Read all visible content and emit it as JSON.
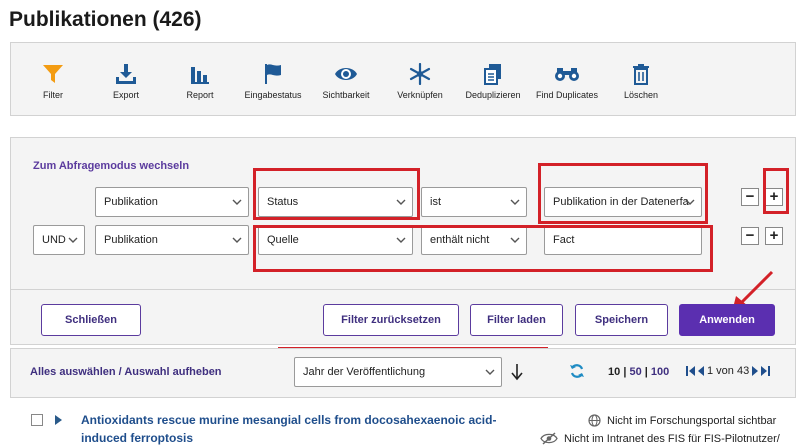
{
  "page": {
    "title": "Publikationen (426)"
  },
  "toolbar": {
    "items": [
      {
        "label": "Filter",
        "icon": "funnel-icon"
      },
      {
        "label": "Export",
        "icon": "download-icon"
      },
      {
        "label": "Report",
        "icon": "bar-chart-icon"
      },
      {
        "label": "Eingabestatus",
        "icon": "flag-icon"
      },
      {
        "label": "Sichtbarkeit",
        "icon": "eye-icon"
      },
      {
        "label": "Verknüpfen",
        "icon": "link-snowflake-icon"
      },
      {
        "label": "Deduplizieren",
        "icon": "copy-icon"
      },
      {
        "label": "Find Duplicates",
        "icon": "binoculars-icon"
      },
      {
        "label": "Löschen",
        "icon": "trash-icon"
      }
    ]
  },
  "filter": {
    "mode_link": "Zum Abfragemodus wechseln",
    "row1": {
      "entity": "Publikation",
      "field": "Status",
      "operator": "ist",
      "value": "Publikation in der Datenerfa"
    },
    "row2": {
      "conjunction": "UND",
      "entity": "Publikation",
      "field": "Quelle",
      "operator": "enthält nicht",
      "value": "Fact"
    },
    "minus": "−",
    "plus": "+",
    "buttons": {
      "close": "Schließen",
      "reset": "Filter zurücksetzen",
      "load": "Filter laden",
      "save": "Speichern",
      "apply": "Anwenden"
    }
  },
  "results": {
    "select_all": "Alles auswählen / Auswahl aufheben",
    "sort_by": "Jahr der Veröffentlichung",
    "page_sizes": [
      "10",
      "50",
      "100"
    ],
    "page_info": "1 von 43",
    "records": [
      {
        "title": "Antioxidants rescue murine mesangial cells from docosahexaenoic acid-induced ferroptosis",
        "visibility1": "Nicht im Forschungsportal sichtbar",
        "visibility2": "Nicht im Intranet des FIS für FIS-Pilotnutzer/"
      }
    ]
  },
  "colors": {
    "accent": "#5b2fb0",
    "link": "#3f2f7f",
    "highlight": "#d32128",
    "icon_blue": "#1f5a96",
    "filter_icon": "#f39c12"
  }
}
